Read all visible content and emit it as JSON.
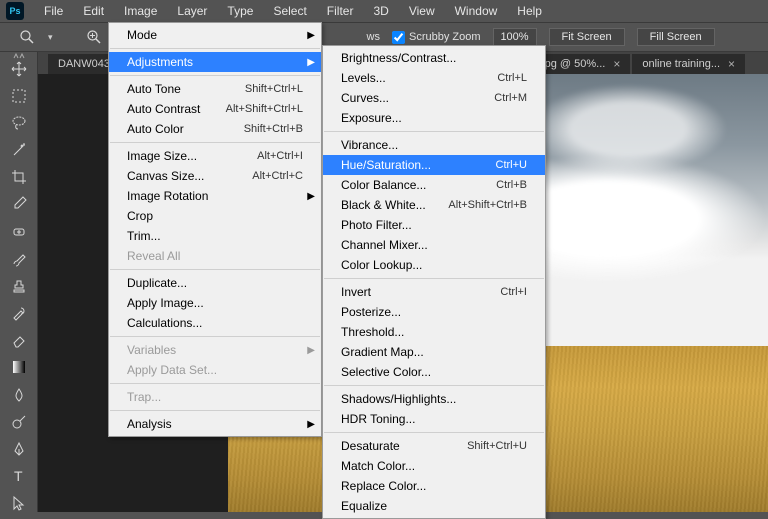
{
  "app": {
    "logo": "Ps"
  },
  "menubar": [
    "File",
    "Edit",
    "Image",
    "Layer",
    "Type",
    "Select",
    "Filter",
    "3D",
    "View",
    "Window",
    "Help"
  ],
  "options": {
    "scrubby_label": "Scrubby Zoom",
    "scrubby_checked": true,
    "zoom_value": "100%",
    "fit_screen": "Fit Screen",
    "fill_screen": "Fill Screen",
    "ws_label": "ws"
  },
  "tabs": [
    {
      "label": "DANW043..."
    },
    {
      "label": "W0440a.jpg @ 50%..."
    },
    {
      "label": "online training..."
    }
  ],
  "image_menu": {
    "groups": [
      [
        {
          "label": "Mode",
          "arrow": true
        }
      ],
      [
        {
          "label": "Adjustments",
          "arrow": true,
          "highlight": true
        }
      ],
      [
        {
          "label": "Auto Tone",
          "shortcut": "Shift+Ctrl+L"
        },
        {
          "label": "Auto Contrast",
          "shortcut": "Alt+Shift+Ctrl+L"
        },
        {
          "label": "Auto Color",
          "shortcut": "Shift+Ctrl+B"
        }
      ],
      [
        {
          "label": "Image Size...",
          "shortcut": "Alt+Ctrl+I"
        },
        {
          "label": "Canvas Size...",
          "shortcut": "Alt+Ctrl+C"
        },
        {
          "label": "Image Rotation",
          "arrow": true
        },
        {
          "label": "Crop"
        },
        {
          "label": "Trim..."
        },
        {
          "label": "Reveal All",
          "disabled": true
        }
      ],
      [
        {
          "label": "Duplicate..."
        },
        {
          "label": "Apply Image..."
        },
        {
          "label": "Calculations..."
        }
      ],
      [
        {
          "label": "Variables",
          "arrow": true,
          "disabled": true
        },
        {
          "label": "Apply Data Set...",
          "disabled": true
        }
      ],
      [
        {
          "label": "Trap...",
          "disabled": true
        }
      ],
      [
        {
          "label": "Analysis",
          "arrow": true
        }
      ]
    ]
  },
  "adjustments_submenu": {
    "groups": [
      [
        {
          "label": "Brightness/Contrast..."
        },
        {
          "label": "Levels...",
          "shortcut": "Ctrl+L"
        },
        {
          "label": "Curves...",
          "shortcut": "Ctrl+M"
        },
        {
          "label": "Exposure..."
        }
      ],
      [
        {
          "label": "Vibrance..."
        },
        {
          "label": "Hue/Saturation...",
          "shortcut": "Ctrl+U",
          "highlight": true
        },
        {
          "label": "Color Balance...",
          "shortcut": "Ctrl+B"
        },
        {
          "label": "Black & White...",
          "shortcut": "Alt+Shift+Ctrl+B"
        },
        {
          "label": "Photo Filter..."
        },
        {
          "label": "Channel Mixer..."
        },
        {
          "label": "Color Lookup..."
        }
      ],
      [
        {
          "label": "Invert",
          "shortcut": "Ctrl+I"
        },
        {
          "label": "Posterize..."
        },
        {
          "label": "Threshold..."
        },
        {
          "label": "Gradient Map..."
        },
        {
          "label": "Selective Color..."
        }
      ],
      [
        {
          "label": "Shadows/Highlights..."
        },
        {
          "label": "HDR Toning..."
        }
      ],
      [
        {
          "label": "Desaturate",
          "shortcut": "Shift+Ctrl+U"
        },
        {
          "label": "Match Color..."
        },
        {
          "label": "Replace Color..."
        },
        {
          "label": "Equalize"
        }
      ]
    ]
  }
}
